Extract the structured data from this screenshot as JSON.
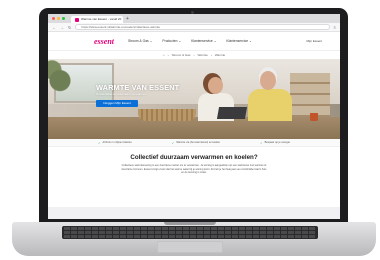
{
  "browser": {
    "tab_title": "Warmte van Essent - vanaf 20",
    "tab_close": "×",
    "new_tab": "+",
    "url": "https://www.essent.nl/warmte-en-koelen/collectieve-warmte",
    "traffic_colors": [
      "#ff5f57",
      "#febc2e",
      "#28c840"
    ]
  },
  "site": {
    "logo": "essent",
    "nav": [
      "Stroom & Gas ⌄",
      "Producten ⌄",
      "Klantenservice ⌄",
      "Klantenservice ⌄"
    ],
    "mijn": "Mijn Essent"
  },
  "breadcrumb": [
    "⌂",
    "›",
    "Stroom & Gas",
    "›",
    "Warmte",
    "›",
    "Warmte"
  ],
  "hero": {
    "title": "WARMTE VAN ESSENT",
    "subtitle": "Comfortabel en duurzaam verwarmen",
    "button": "Inloggen Mijn Essent"
  },
  "usps": [
    "Al Ruim 1 miljoen klanten",
    "Warmte via (het warmtenet) en koelen",
    "Bespaar op je energie"
  ],
  "content": {
    "heading": "Collectief duurzaam verwarmen en koelen?",
    "body": "Collectieve warmtelevering is een duurzame manier om te verwarmen. Je woning is aangesloten op een warmtenet met warmte uit duurzame bronnen. Essent zorgt ervoor dat het warme water bij je woning komt. Zo heb je het hele jaar een comfortabel warm huis en de levering is zeker."
  },
  "colors": {
    "brand": "#e5007d",
    "button": "#0b6fd8",
    "check": "#2a9d3f"
  }
}
